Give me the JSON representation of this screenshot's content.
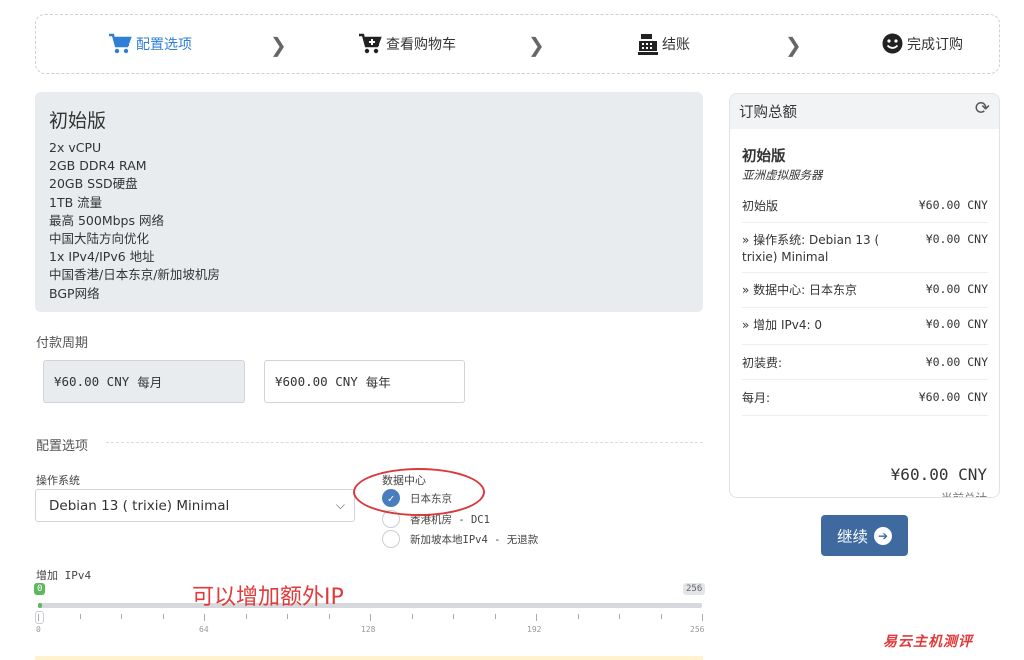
{
  "stepper": {
    "steps": [
      {
        "label": "配置选项",
        "icon": "cart-icon"
      },
      {
        "label": "查看购物车",
        "icon": "cart-plus-icon"
      },
      {
        "label": "结账",
        "icon": "cash-register-icon"
      },
      {
        "label": "完成订购",
        "icon": "smile-icon"
      }
    ],
    "active_color": "#2f7fd6"
  },
  "product": {
    "name": "初始版",
    "features": [
      "2x vCPU",
      "2GB DDR4 RAM",
      "20GB SSD硬盘",
      "1TB 流量",
      "最高 500Mbps 网络",
      "中国大陆方向优化",
      "1x IPv4/IPv6 地址",
      "中国香港/日本东京/新加坡机房",
      "BGP网络"
    ]
  },
  "billing": {
    "label": "付款周期",
    "options": [
      {
        "price": "¥60.00 CNY",
        "period": "每月",
        "selected": true
      },
      {
        "price": "¥600.00 CNY",
        "period": "每年",
        "selected": false
      }
    ]
  },
  "config": {
    "section_label": "配置选项",
    "os_label": "操作系统",
    "os_value": "Debian 13 ( trixie) Minimal",
    "dc_label": "数据中心",
    "dc_options": [
      {
        "label": "日本东京",
        "checked": true
      },
      {
        "label": "香港机房 - DC1",
        "checked": false
      },
      {
        "label": "新加坡本地IPv4 - 无退款",
        "checked": false
      }
    ],
    "ipv4_label": "增加 IPv4",
    "ipv4_value": 0,
    "ipv4_min_badge": "0",
    "ipv4_max_badge": "256",
    "ipv4_tick_labels": [
      "0",
      "64",
      "128",
      "192",
      "256"
    ]
  },
  "annotation": "可以增加额外IP",
  "summary": {
    "title": "订购总额",
    "product_name": "初始版",
    "product_group": "亚洲虚拟服务器",
    "rows": [
      {
        "label": "初始版",
        "value": "¥60.00 CNY"
      },
      {
        "label": "» 操作系统: Debian 13 ( trixie) Minimal",
        "value": "¥0.00 CNY"
      },
      {
        "label": "» 数据中心: 日本东京",
        "value": "¥0.00 CNY"
      },
      {
        "label": "» 增加 IPv4: 0",
        "value": "¥0.00 CNY"
      },
      {
        "label": "初装费:",
        "value": "¥0.00 CNY"
      },
      {
        "label": "每月:",
        "value": "¥60.00 CNY"
      }
    ],
    "total": "¥60.00 CNY",
    "total_label": "当前总计"
  },
  "continue_label": "继续",
  "watermark": "易云主机测评"
}
